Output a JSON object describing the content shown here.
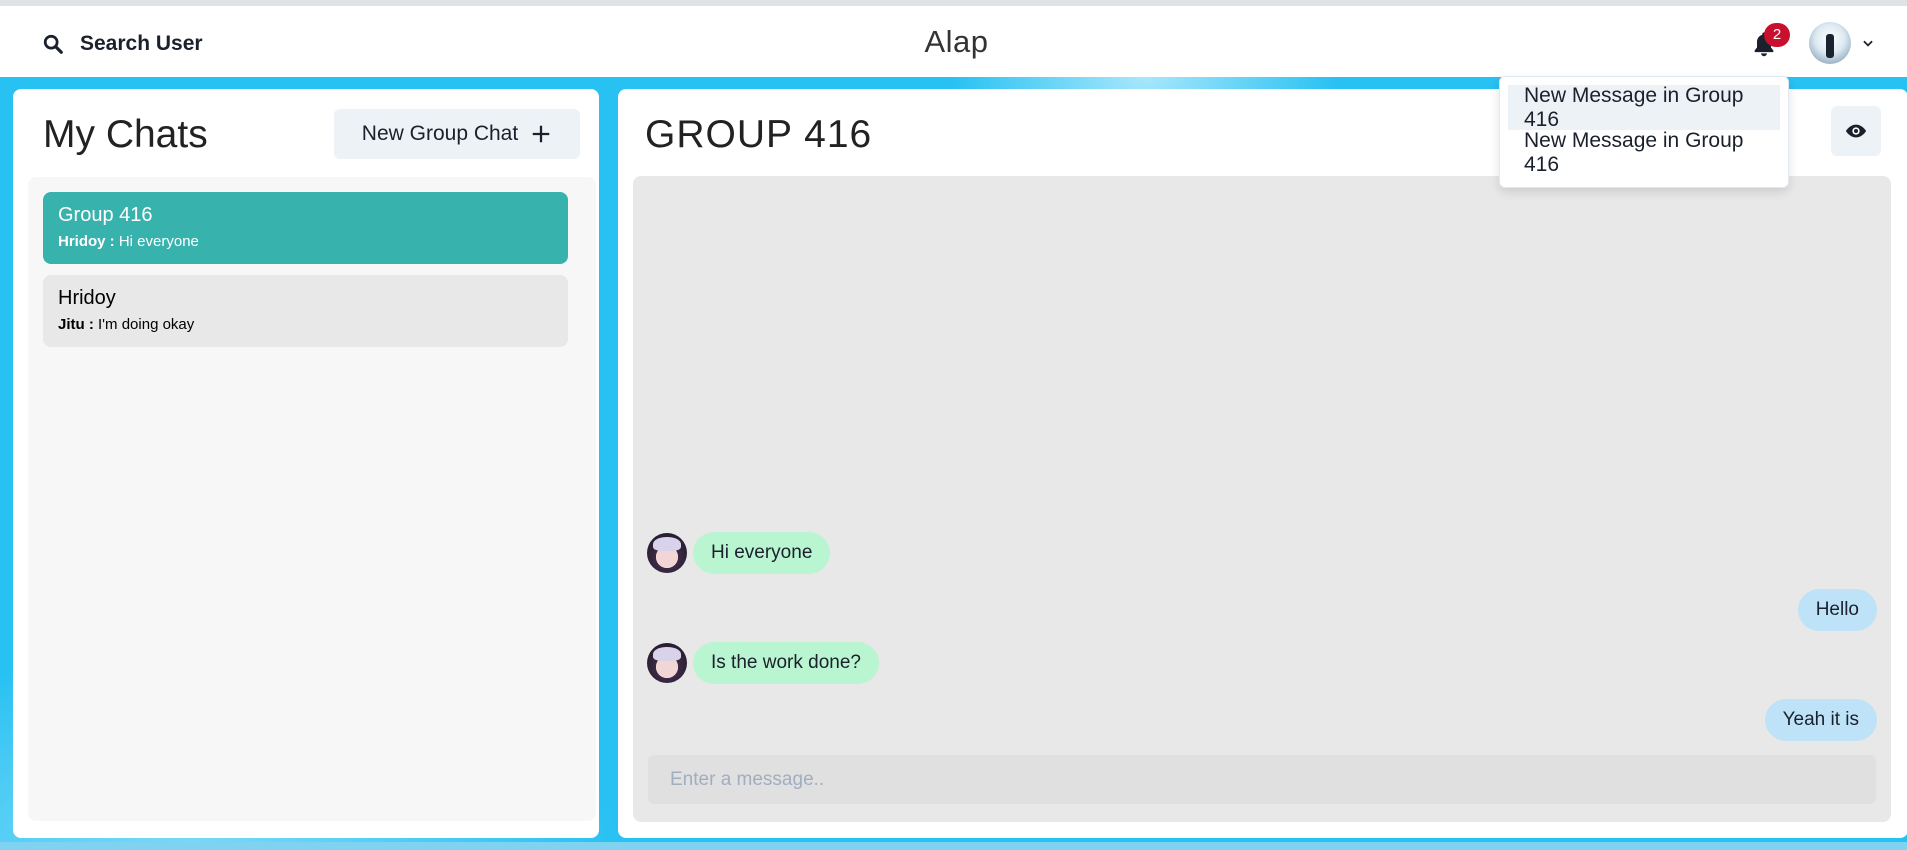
{
  "header": {
    "search_label": "Search User",
    "app_title": "Alap",
    "notification_count": "2"
  },
  "notifications": [
    {
      "label": "New Message in Group 416"
    },
    {
      "label": "New Message in Group 416"
    }
  ],
  "sidebar": {
    "title": "My Chats",
    "new_group_label": "New Group Chat",
    "chats": [
      {
        "name": "Group 416",
        "sender": "Hridoy :",
        "preview": "Hi everyone",
        "active": true
      },
      {
        "name": "Hridoy",
        "sender": "Jitu :",
        "preview": "I'm doing okay",
        "active": false
      }
    ]
  },
  "conversation": {
    "title": "GROUP 416",
    "messages": [
      {
        "text": "Hi everyone",
        "direction": "in"
      },
      {
        "text": "Hello",
        "direction": "out"
      },
      {
        "text": "Is the work done?",
        "direction": "in"
      },
      {
        "text": "Yeah it is",
        "direction": "out"
      }
    ],
    "input_placeholder": "Enter a message.."
  },
  "colors": {
    "accent": "#38b2ac",
    "incoming_bubble": "#b9f5d0",
    "outgoing_bubble": "#bee3f8",
    "background": "#27c1f2",
    "badge": "#c8102e"
  },
  "icons": [
    "search-icon",
    "bell-icon",
    "chevron-down-icon",
    "plus-icon",
    "eye-icon"
  ]
}
